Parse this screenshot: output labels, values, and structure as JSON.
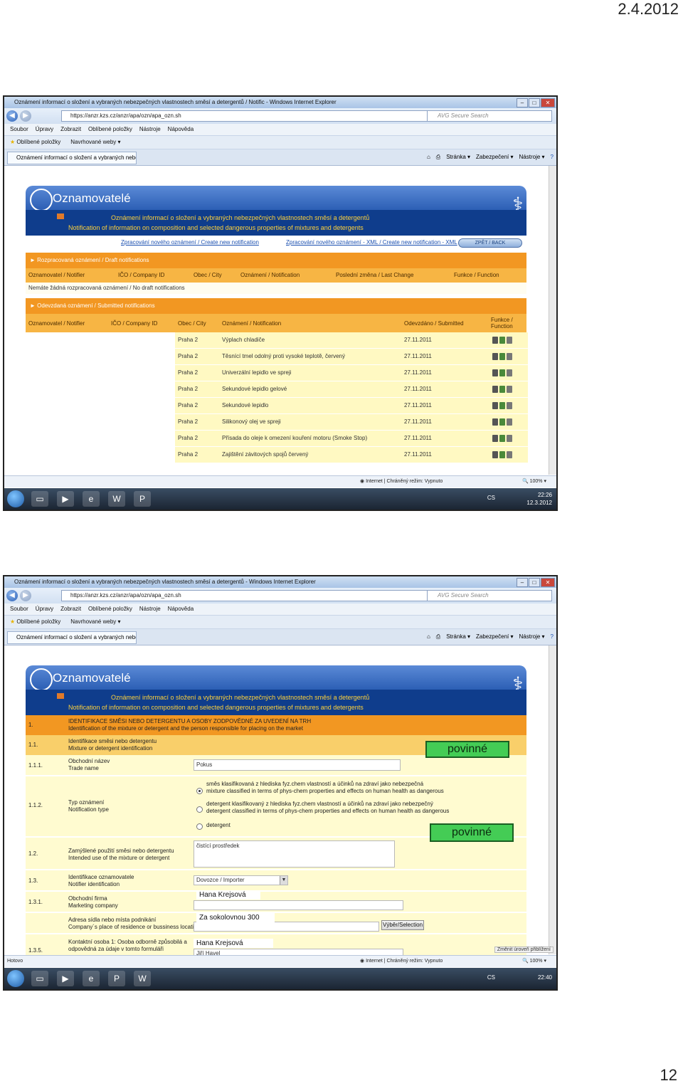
{
  "header_date": "2.4.2012",
  "page_number": "12",
  "screenshot1": {
    "window_title": "Oznámení informací o složení a vybraných nebezpečných vlastnostech směsí a detergentů / Notific - Windows Internet Explorer",
    "url": "https://anzr.kzs.cz/anzr/apa/ozn/apa_ozn.sh",
    "search_placeholder": "AVG Secure Search",
    "menu": [
      "Soubor",
      "Úpravy",
      "Zobrazit",
      "Oblíbené položky",
      "Nástroje",
      "Nápověda"
    ],
    "favorites": [
      "Oblíbené položky",
      "Navrhované weby ▾"
    ],
    "tab_label": "Oznámení informací o složení a vybraných nebezpečn...",
    "command_tools": [
      "Stránka ▾",
      "Zabezpečení ▾",
      "Nástroje ▾"
    ],
    "app_title": "Oznamovatelé",
    "subtitle_cz": "Oznámení informací o složení a vybraných nebezpečných vlastnostech směsí a detergentů",
    "subtitle_en": "Notification of information on composition and selected dangerous properties of mixtures and detergents",
    "link_create": "Zpracování nového oznámení / Create new notification",
    "link_create_xml": "Zpracování nového oznámení - XML / Create new notification - XML",
    "back_button": "ZPĚT / BACK",
    "draft_section": "► Rozpracovaná oznámení / Draft notifications",
    "draft_columns": [
      "Oznamovatel / Notifier",
      "IČO / Company ID",
      "Obec / City",
      "Oznámení / Notification",
      "Poslední změna / Last Change",
      "Funkce / Function"
    ],
    "draft_empty": "Nemáte žádná rozpracovaná oznámení / No draft notifications",
    "submitted_section": "► Odevzdaná oznámení / Submitted notifications",
    "submitted_columns": [
      "Oznamovatel / Notifier",
      "IČO / Company ID",
      "Obec / City",
      "Oznámení / Notification",
      "Odevzdáno / Submitted",
      "Funkce / Function"
    ],
    "rows": [
      {
        "city": "Praha 2",
        "notification": "Výplach chladiče",
        "submitted": "27.11.2011"
      },
      {
        "city": "Praha 2",
        "notification": "Těsnící tmel odolný proti vysoké teplotě, červený",
        "submitted": "27.11.2011"
      },
      {
        "city": "Praha 2",
        "notification": "Univerzální lepidlo ve spreji",
        "submitted": "27.11.2011"
      },
      {
        "city": "Praha 2",
        "notification": "Sekundové lepidlo gelové",
        "submitted": "27.11.2011"
      },
      {
        "city": "Praha 2",
        "notification": "Sekundové lepidlo",
        "submitted": "27.11.2011"
      },
      {
        "city": "Praha 2",
        "notification": "Silikonový olej ve spreji",
        "submitted": "27.11.2011"
      },
      {
        "city": "Praha 2",
        "notification": "Přísada do oleje k omezení kouření motoru (Smoke Stop)",
        "submitted": "27.11.2011"
      },
      {
        "city": "Praha 2",
        "notification": "Zajištění závitových spojů červený",
        "submitted": "27.11.2011"
      }
    ],
    "status_text": "Internet | Chráněný režim: Vypnuto",
    "zoom": "100%",
    "tray_lang": "CS",
    "tray_time": "22:26",
    "tray_date": "12.3.2012"
  },
  "screenshot2": {
    "window_title": "Oznámení informací o složení a vybraných nebezpečných vlastnostech směsí a detergentů - Windows Internet Explorer",
    "url": "https://anzr.kzs.cz/anzr/apa/ozn/apa_ozn.sh",
    "search_placeholder": "AVG Secure Search",
    "menu": [
      "Soubor",
      "Úpravy",
      "Zobrazit",
      "Oblíbené položky",
      "Nástroje",
      "Nápověda"
    ],
    "favorites": [
      "Oblíbené položky",
      "Navrhované weby ▾"
    ],
    "tab_label": "Oznámení informací o složení a vybraných nebezpečn...",
    "command_tools": [
      "Stránka ▾",
      "Zabezpečení ▾",
      "Nástroje ▾"
    ],
    "app_title": "Oznamovatelé",
    "subtitle_cz": "Oznámení informací o složení a vybraných nebezpečných vlastnostech směsí a detergentů",
    "subtitle_en": "Notification of information on composition and selected dangerous properties of mixtures and detergents",
    "section1_num": "1.",
    "section1_cz": "IDENTIFIKACE SMĚSI NEBO DETERGENTU A OSOBY ZODPOVĚDNÉ ZA UVEDENÍ NA TRH",
    "section1_en": "Identification of the mixture or detergent and the person responsible for placing on the market",
    "r11_num": "1.1.",
    "r11_cz": "Identifikace směsi nebo detergentu",
    "r11_en": "Mixture or detergent identification",
    "r111_num": "1.1.1.",
    "r111_cz": "Obchodní název",
    "r111_en": "Trade name",
    "r111_value": "Pokus",
    "r112_num": "1.1.2.",
    "r112_cz": "Typ oznámení",
    "r112_en": "Notification type",
    "opt1_cz": "směs klasifikovaná z hlediska fyz.chem vlastností a účinků na zdraví jako nebezpečná",
    "opt1_en": "mixture classified in terms of phys-chem properties and effects on human health as dangerous",
    "opt2_cz": "detergent klasifikovaný z hlediska fyz.chem vlastností a účinků na zdraví jako nebezpečný",
    "opt2_en": "detergent classified in terms of phys-chem properties and effects on human health as dangerous",
    "opt3": "detergent",
    "r12_num": "1.2.",
    "r12_cz": "Zamýšlené použití směsi nebo detergentu",
    "r12_en": "Intended use of the mixture or detergent",
    "r12_value": "čistící prostředek",
    "r13_num": "1.3.",
    "r13_cz": "Identifikace oznamovatele",
    "r13_en": "Notifier identification",
    "r13_value": "Dovozce / Importer",
    "r131_num": "1.3.1.",
    "r131_cz": "Obchodní firma",
    "r131_en": "Marketing company",
    "r131_overlay": "Hana Krejsová",
    "address_cz": "Adresa sídla nebo místa podnikání",
    "address_en": "Company´s place of residence or bussiness location",
    "address_overlay": "Za sokolovnou 300",
    "select_button": "Výběr/Selection",
    "r135_num": "1.3.5.",
    "r135_cz": "Kontaktní osoba 1: Osoba odborně způsobilá a odpovědná za údaje v tomto formuláři",
    "r135_overlay": "Hana Krejsová",
    "r135_value2": "Jiří Havel",
    "povinne1": "povinné",
    "povinne2": "povinné",
    "status_left": "Hotovo",
    "status_text": "Internet | Chráněný režim: Vypnuto",
    "zoom": "100%",
    "change_level": "Změnit úroveň přiblížení",
    "tray_lang": "CS",
    "tray_time": "22:40"
  }
}
